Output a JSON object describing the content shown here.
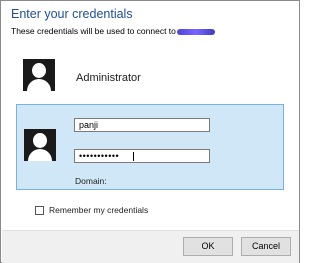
{
  "dialog": {
    "title": "Enter your credentials",
    "subtitle": "These credentials will be used to connect to"
  },
  "accounts": {
    "admin_name": "Administrator"
  },
  "credentials": {
    "username_value": "panji",
    "password_value": "•••••••••••",
    "domain_label": "Domain:"
  },
  "remember": {
    "label": "Remember my credentials",
    "checked": false
  },
  "buttons": {
    "ok_label": "OK",
    "cancel_label": "Cancel"
  },
  "colors": {
    "title_blue": "#1f4e9e",
    "selection_fill": "#cfe7f7",
    "selection_border": "#77b3e0"
  },
  "icons": [
    "user-avatar-icon",
    "checkbox-icon"
  ]
}
